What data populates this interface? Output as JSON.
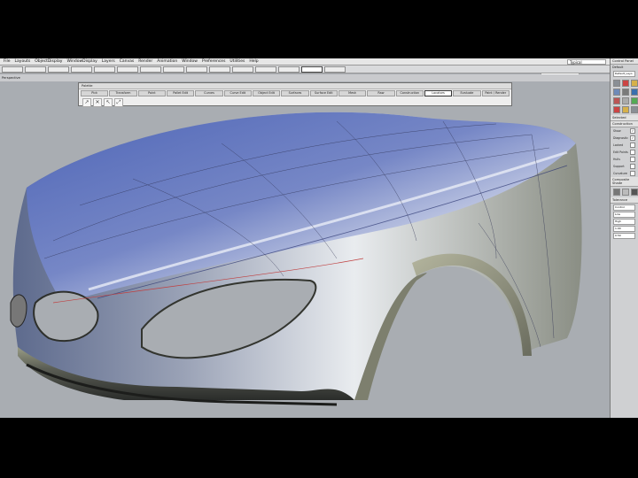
{
  "menu": [
    "File",
    "Layouts",
    "ObjectDisplay",
    "WindowDisplay",
    "Layers",
    "Canvas",
    "Render",
    "Animation",
    "Window",
    "Preferences",
    "Utilities",
    "Help"
  ],
  "title_field": "Typical",
  "toolbar": {
    "buttons": [
      "",
      "",
      "",
      "",
      "",
      "",
      "",
      "",
      "",
      "",
      "",
      "",
      "",
      "",
      ""
    ],
    "active_index": 13,
    "info": "Untitled",
    "brush_text": "Go  mouse  x drag  Stroke  R  Size  2 px  Layout  4  Soft  ext  Randle  Str  Length  Scale  1",
    "name_tag": "Name",
    "info_box": "Multiplicity Lab"
  },
  "subbar": {
    "view": "Perspective"
  },
  "palette": {
    "title": "Palette",
    "tabs": [
      "Pick",
      "Transform",
      "Point",
      "Pallet Edit",
      "Curves",
      "Curve Edit",
      "Object Edit",
      "Surfaces",
      "Surface Edit",
      "Mesh",
      "Raw",
      "Construction",
      "Locators",
      "Evaluate",
      "Paint / Render"
    ],
    "active_tab": 12,
    "icons": [
      "↗",
      "✕",
      "↖",
      "⤢"
    ]
  },
  "right_panel": {
    "title": "Control Panel",
    "default_label": "Default",
    "field1": "Default_Layo",
    "section1": "Selected",
    "section2": "Construction",
    "toggles": [
      {
        "label": "Show",
        "value": "✓"
      },
      {
        "label": "Diagnostic",
        "value": "✓"
      },
      {
        "label": "Locked",
        "value": ""
      },
      {
        "label": "Edit Points",
        "value": ""
      },
      {
        "label": "Hulls",
        "value": ""
      },
      {
        "label": "Support",
        "value": ""
      },
      {
        "label": "Curvature",
        "value": ""
      }
    ],
    "section3": "Composite Shade",
    "section4": "Tolerance",
    "fields": [
      "Control",
      "Low",
      "High",
      "1.00",
      "0.50"
    ],
    "icon_colors": [
      "#8a8f95",
      "#c44",
      "#d6b04a",
      "#6e8ab8",
      "#7a7a7a",
      "#3a6fae",
      "#b55",
      "#aaa",
      "#5a5"
    ]
  }
}
